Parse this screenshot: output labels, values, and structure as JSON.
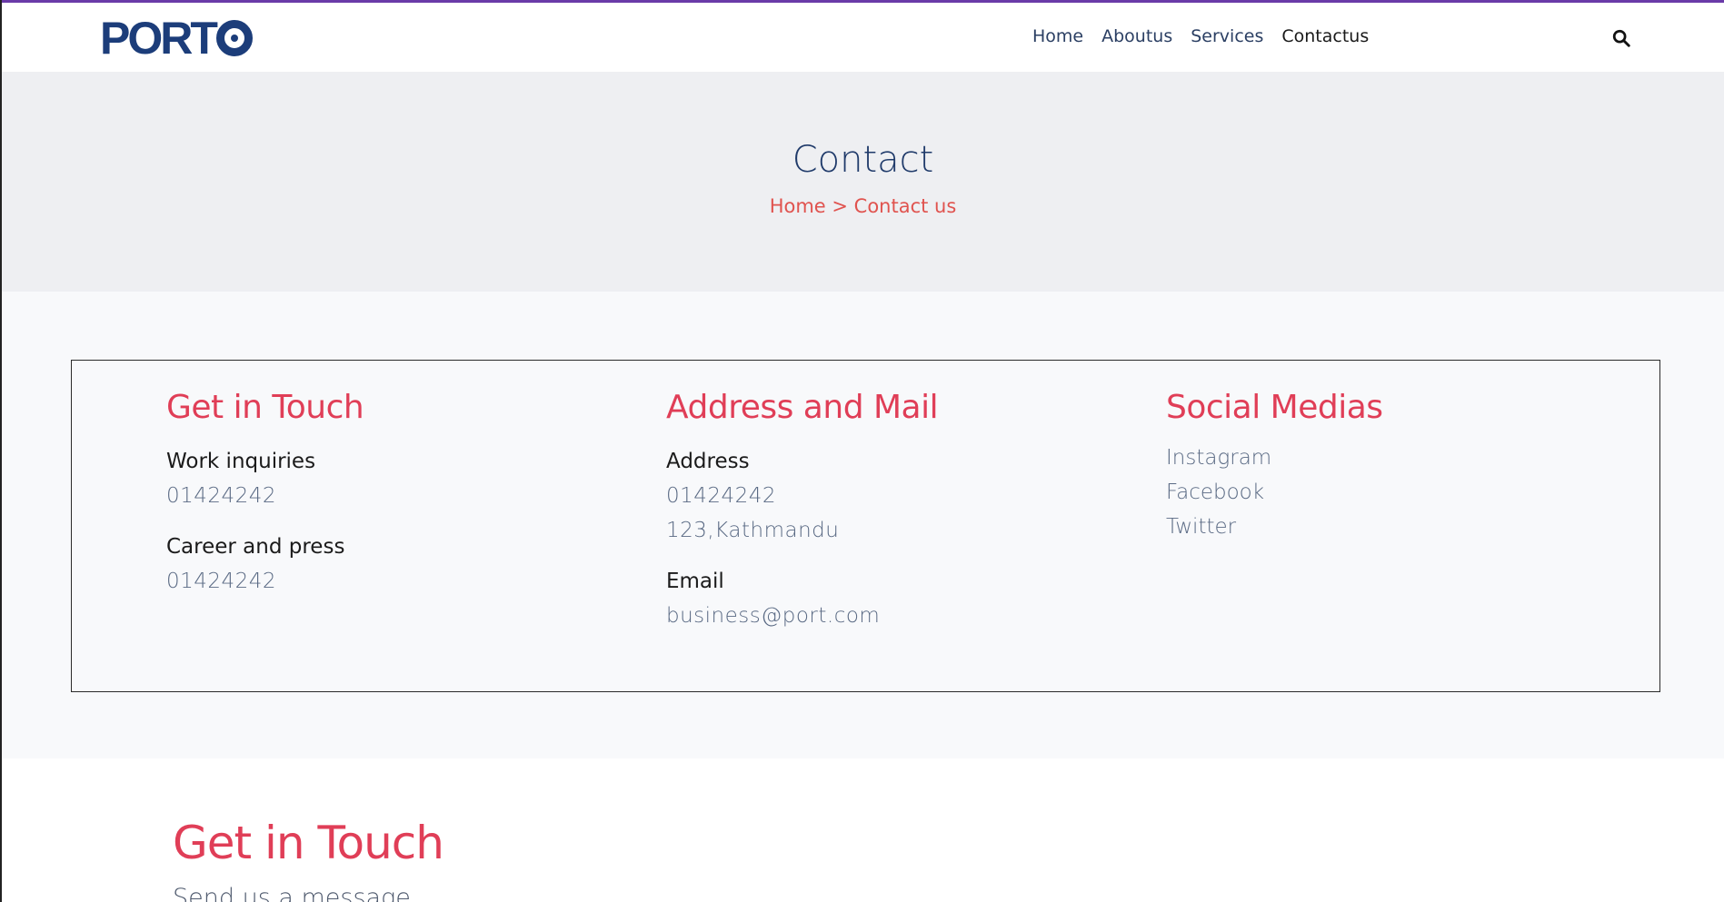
{
  "brand": {
    "logo_text": "PORT",
    "accent_color": "#6a3aa8",
    "brand_color": "#1c3d7a"
  },
  "nav": {
    "items": [
      {
        "label": "Home"
      },
      {
        "label": "Aboutus"
      },
      {
        "label": "Services"
      },
      {
        "label": "Contactus"
      }
    ],
    "search_icon": "search-icon"
  },
  "banner": {
    "title": "Contact",
    "breadcrumb": "Home > Contact us"
  },
  "info": {
    "get_in_touch": {
      "heading": "Get in Touch",
      "work_label": "Work inquiries",
      "work_value": "01424242",
      "career_label": "Career and press",
      "career_value": "01424242"
    },
    "address_mail": {
      "heading": "Address and Mail",
      "address_label": "Address",
      "address_phone": "01424242",
      "address_value": "123,Kathmandu",
      "email_label": "Email",
      "email_value": "business@port.com"
    },
    "social": {
      "heading": "Social Medias",
      "links": [
        "Instagram",
        "Facebook",
        "Twitter"
      ]
    }
  },
  "form_section": {
    "heading": "Get in Touch",
    "subheading": "Send us a message"
  },
  "colors": {
    "heading_red": "#e03e57",
    "breadcrumb_red": "#e0534f",
    "banner_bg": "#eeeff2",
    "section_bg": "#f8f9fb"
  }
}
